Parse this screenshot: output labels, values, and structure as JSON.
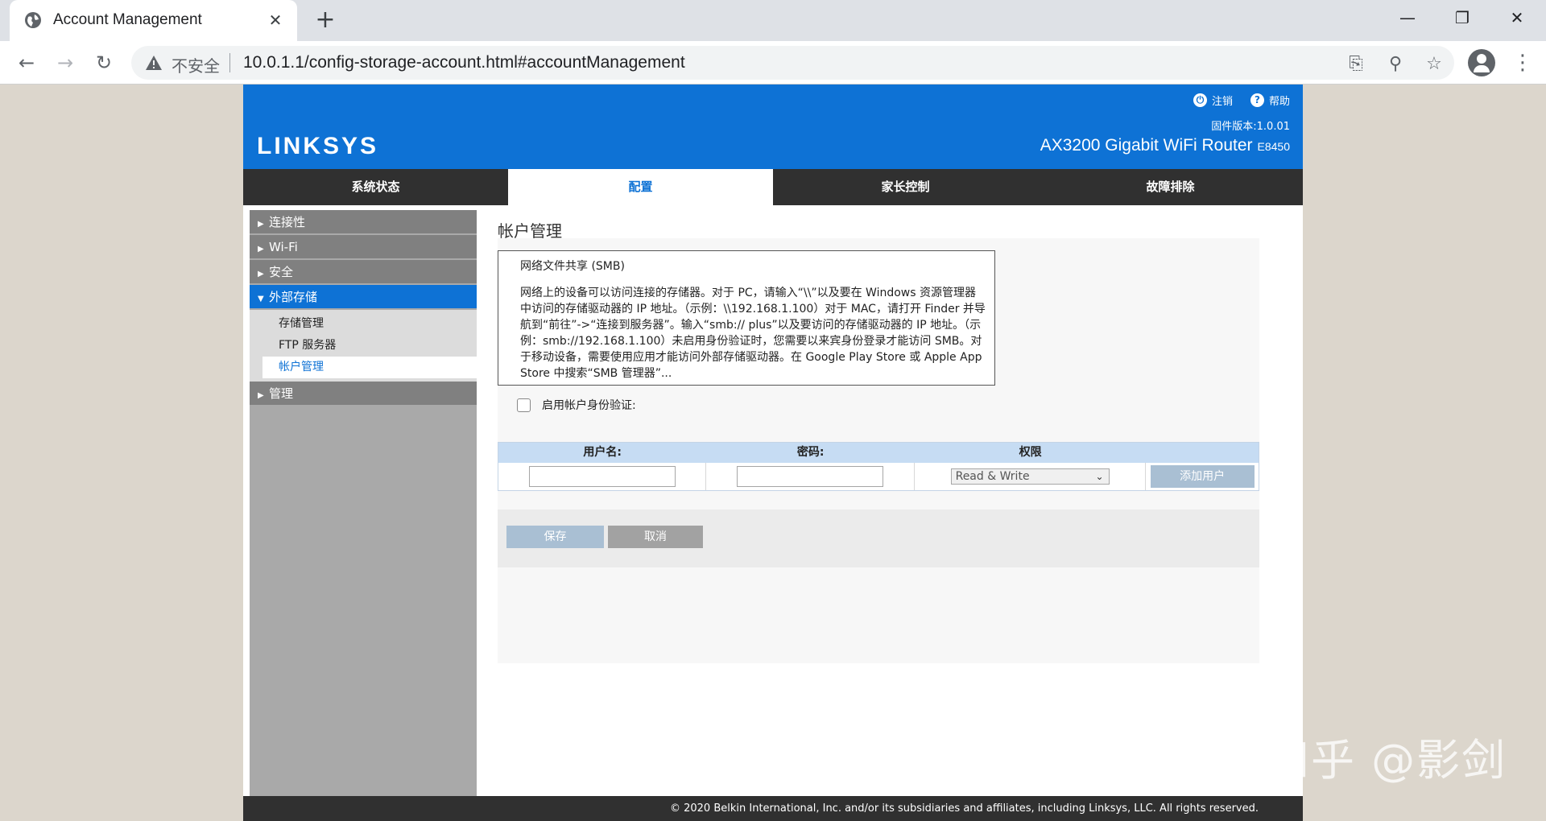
{
  "browser": {
    "tab_title": "Account Management",
    "tab_close": "✕",
    "new_tab": "+",
    "insecure_label": "不安全",
    "url": "10.0.1.1/config-storage-account.html#accountManagement",
    "window": {
      "minimize": "—",
      "restore": "❐",
      "close": "✕"
    },
    "nav": {
      "back": "←",
      "forward": "→",
      "reload": "↻"
    },
    "icons": {
      "translate": "⎘",
      "zoom": "⚲",
      "bookmark": "☆",
      "menu": "⋮"
    }
  },
  "header": {
    "logo": "LINKSYS",
    "logout": "注销",
    "help": "帮助",
    "firmware": "固件版本:1.0.01",
    "model_name": "AX3200 Gigabit WiFi Router",
    "model_code": "E8450"
  },
  "mainnav": [
    "系统状态",
    "配置",
    "家长控制",
    "故障排除"
  ],
  "sidebar": {
    "items": [
      {
        "label": "连接性"
      },
      {
        "label": "Wi-Fi"
      },
      {
        "label": "安全"
      },
      {
        "label": "外部存储"
      },
      {
        "label": "管理"
      }
    ],
    "subitems": [
      {
        "label": "存储管理"
      },
      {
        "label": "FTP 服务器"
      },
      {
        "label": "帐户管理"
      }
    ]
  },
  "content": {
    "title": "帐户管理",
    "smb_title": "网络文件共享 (SMB)",
    "smb_text": "网络上的设备可以访问连接的存储器。对于 PC，请输入“\\\\”以及要在 Windows 资源管理器中访问的存储驱动器的 IP 地址。（示例：\\\\192.168.1.100）对于 MAC，请打开 Finder 并导航到“前往”->“连接到服务器”。输入“smb:// plus”以及要访问的存储驱动器的 IP 地址。（示例：smb://192.168.1.100）未启用身份验证时，您需要以来宾身份登录才能访问 SMB。对于移动设备，需要使用应用才能访问外部存储驱动器。在 Google Play Store 或 Apple App Store 中搜索“SMB 管理器”...",
    "auth_label": "启用帐户身份验证:",
    "table_headers": [
      "用户名:",
      "密码:",
      "权限",
      ""
    ],
    "permission_value": "Read & Write",
    "add_user": "添加用户",
    "save": "保存",
    "cancel": "取消"
  },
  "footer": "© 2020 Belkin International, Inc. and/or its subsidiaries and affiliates, including Linksys, LLC. All rights reserved.",
  "watermark": "知乎 @影剑",
  "colors": {
    "brand_blue": "#0e72d5",
    "nav_dark": "#303030",
    "sidebar_gray": "#a9a9a9",
    "disabled_btn": "#a9bfd3"
  }
}
